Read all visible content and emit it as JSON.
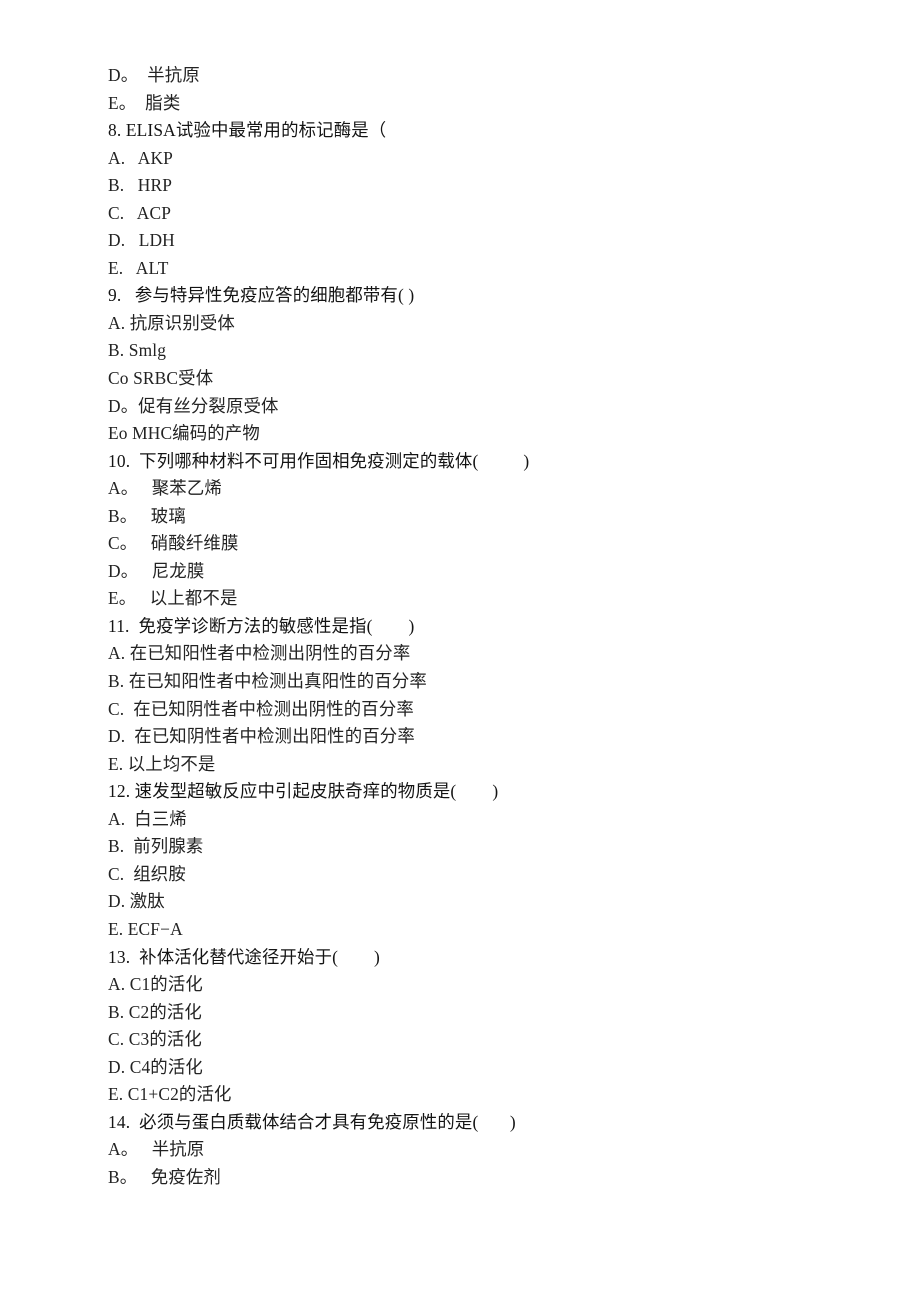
{
  "document": {
    "type": "exam-paper",
    "language": "zh-CN",
    "background_color": "#ffffff",
    "text_color": "#1f1f1f"
  },
  "lines": [
    {
      "id": "l1",
      "kind": "option",
      "text": "D。  半抗原"
    },
    {
      "id": "l2",
      "kind": "option",
      "text": "E。  脂类"
    },
    {
      "id": "l3",
      "kind": "question",
      "text": "8. ELISA试验中最常用的标记酶是（"
    },
    {
      "id": "l4",
      "kind": "option",
      "text": "A.   AKP"
    },
    {
      "id": "l5",
      "kind": "option",
      "text": "B.   HRP"
    },
    {
      "id": "l6",
      "kind": "option",
      "text": "C.   ACP"
    },
    {
      "id": "l7",
      "kind": "option",
      "text": "D.   LDH"
    },
    {
      "id": "l8",
      "kind": "option",
      "text": "E.   ALT"
    },
    {
      "id": "l9",
      "kind": "question",
      "text": "9.   参与特异性免疫应答的细胞都带有( )"
    },
    {
      "id": "l10",
      "kind": "option",
      "text": "A. 抗原识别受体"
    },
    {
      "id": "l11",
      "kind": "option",
      "text": "B. Smlg"
    },
    {
      "id": "l12",
      "kind": "option",
      "text": "Co SRBC受体"
    },
    {
      "id": "l13",
      "kind": "option",
      "text": "D。促有丝分裂原受体"
    },
    {
      "id": "l14",
      "kind": "option",
      "text": "Eo MHC编码的产物"
    },
    {
      "id": "l15",
      "kind": "question",
      "text": "10.  下列哪种材料不可用作固相免疫测定的载体(          )"
    },
    {
      "id": "l16",
      "kind": "option",
      "text": "A。   聚苯乙烯"
    },
    {
      "id": "l17",
      "kind": "option",
      "text": "B。   玻璃"
    },
    {
      "id": "l18",
      "kind": "option",
      "text": "C。   硝酸纤维膜"
    },
    {
      "id": "l19",
      "kind": "option",
      "text": "D。   尼龙膜"
    },
    {
      "id": "l20",
      "kind": "option",
      "text": "E。   以上都不是"
    },
    {
      "id": "l21",
      "kind": "question",
      "text": "11.  免疫学诊断方法的敏感性是指(        )"
    },
    {
      "id": "l22",
      "kind": "option",
      "text": "A. 在已知阳性者中检测出阴性的百分率"
    },
    {
      "id": "l23",
      "kind": "option",
      "text": "B. 在已知阳性者中检测出真阳性的百分率"
    },
    {
      "id": "l24",
      "kind": "option",
      "text": "C.  在已知阴性者中检测出阴性的百分率"
    },
    {
      "id": "l25",
      "kind": "option",
      "text": "D.  在已知阴性者中检测出阳性的百分率"
    },
    {
      "id": "l26",
      "kind": "option",
      "text": "E. 以上均不是"
    },
    {
      "id": "l27",
      "kind": "question",
      "text": "12. 速发型超敏反应中引起皮肤奇痒的物质是(        )"
    },
    {
      "id": "l28",
      "kind": "option",
      "text": "A.  白三烯"
    },
    {
      "id": "l29",
      "kind": "option",
      "text": "B.  前列腺素"
    },
    {
      "id": "l30",
      "kind": "option",
      "text": "C.  组织胺"
    },
    {
      "id": "l31",
      "kind": "option",
      "text": "D. 激肽"
    },
    {
      "id": "l32",
      "kind": "option",
      "text": "E. ECF−A"
    },
    {
      "id": "l33",
      "kind": "question",
      "text": "13.  补体活化替代途径开始于(        )"
    },
    {
      "id": "l34",
      "kind": "option",
      "text": "A. C1的活化"
    },
    {
      "id": "l35",
      "kind": "option",
      "text": "B. C2的活化"
    },
    {
      "id": "l36",
      "kind": "option",
      "text": "C. C3的活化"
    },
    {
      "id": "l37",
      "kind": "option",
      "text": "D. C4的活化"
    },
    {
      "id": "l38",
      "kind": "option",
      "text": "E. C1+C2的活化"
    },
    {
      "id": "l39",
      "kind": "question",
      "text": "14.  必须与蛋白质载体结合才具有免疫原性的是(       )"
    },
    {
      "id": "l40",
      "kind": "option",
      "text": "A。   半抗原"
    },
    {
      "id": "l41",
      "kind": "option",
      "text": "B。   免疫佐剂"
    }
  ]
}
